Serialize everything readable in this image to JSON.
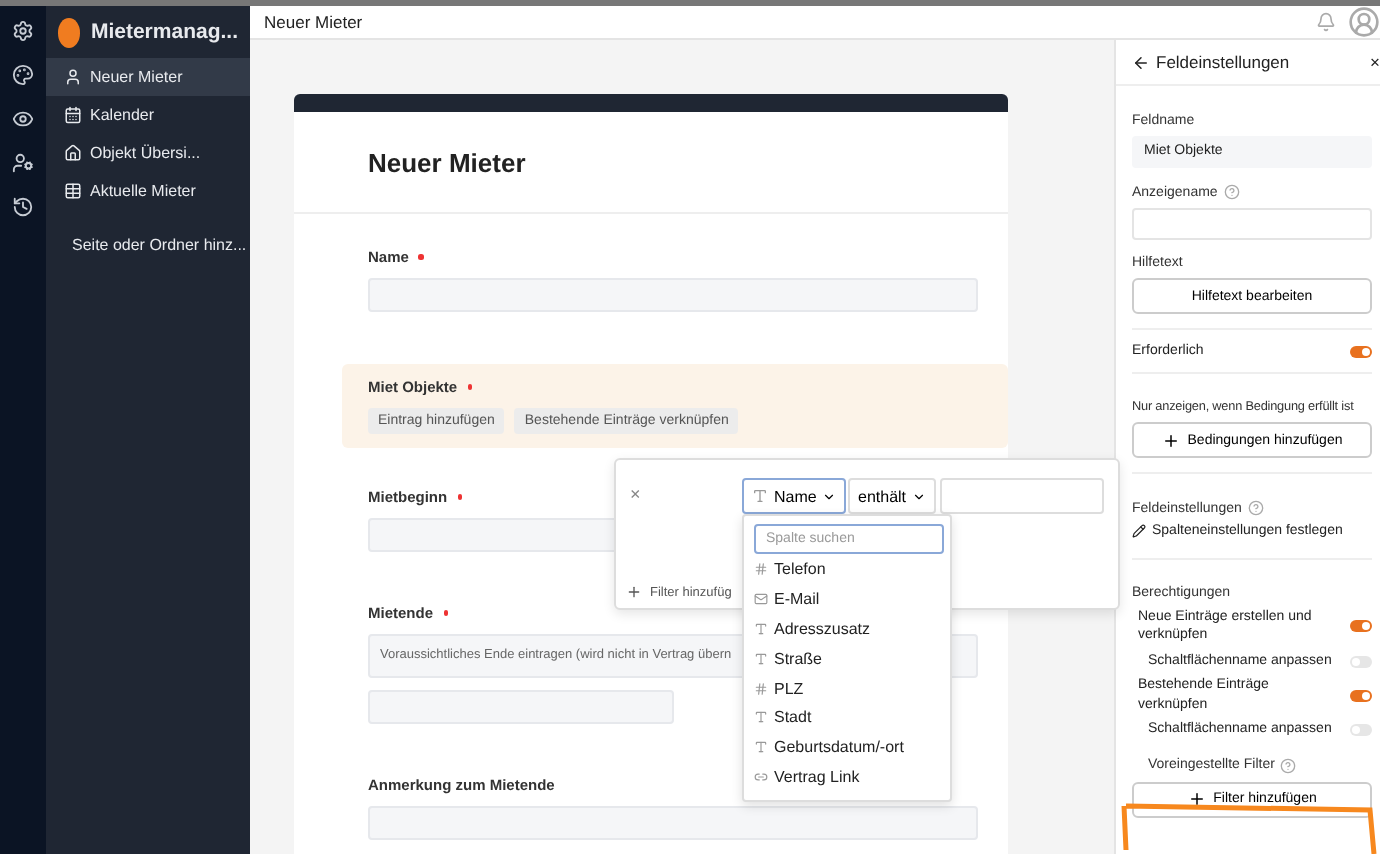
{
  "app": {
    "name": "Mietermanag..."
  },
  "rail": [
    {
      "kind": "gear"
    },
    {
      "kind": "palette"
    },
    {
      "kind": "eye"
    },
    {
      "kind": "user"
    },
    {
      "kind": "history"
    }
  ],
  "sidebar": {
    "items": [
      {
        "label": "Neuer Mieter",
        "kind": "user",
        "selected": true
      },
      {
        "label": "Kalender",
        "kind": "calendar",
        "selected": false
      },
      {
        "label": "Objekt Übersi...",
        "kind": "home",
        "selected": false
      },
      {
        "label": "Aktuelle Mieter",
        "kind": "table",
        "selected": false
      }
    ],
    "add": "Seite oder Ordner hinz..."
  },
  "header": {
    "title": "Neuer Mieter"
  },
  "form": {
    "title": "Neuer Mieter",
    "fields": [
      {
        "kind": "input",
        "label": "Name",
        "required": true,
        "highlighted": false
      },
      {
        "kind": "links",
        "label": "Miet Objekte",
        "required": true,
        "highlighted": true,
        "buttons": [
          "Eintrag hinzufügen",
          "Bestehende Einträge verknüpfen"
        ]
      },
      {
        "kind": "input",
        "label": "Mietbeginn",
        "required": true,
        "highlighted": false
      },
      {
        "kind": "date",
        "label": "Mietende",
        "required": true,
        "highlighted": false,
        "hint": "Voraussichtliches Ende eintragen (wird nicht in Vertrag übern"
      },
      {
        "kind": "input",
        "label": "Anmerkung zum Mietende",
        "required": false,
        "highlighted": false
      }
    ]
  },
  "filter": {
    "close": "×",
    "column": "Name",
    "operator": "enthält",
    "add": "Filter hinzufüg"
  },
  "column_menu": {
    "placeholder": "Spalte suchen",
    "items": [
      {
        "label": "Telefon",
        "kind": "number"
      },
      {
        "label": "E-Mail",
        "kind": "mail"
      },
      {
        "label": "Adresszusatz",
        "kind": "text"
      },
      {
        "label": "Straße",
        "kind": "text"
      },
      {
        "label": "PLZ",
        "kind": "number"
      },
      {
        "label": "Stadt",
        "kind": "text"
      },
      {
        "label": "Geburtsdatum/-ort",
        "kind": "text"
      },
      {
        "label": "Vertrag Link",
        "kind": "link"
      }
    ]
  },
  "panel": {
    "title": "Feldeinstellungen",
    "close": "×",
    "field_name_label": "Feldname",
    "field_name": "Miet Objekte",
    "display_name_label": "Anzeigename",
    "help_label": "Hilfetext",
    "help_button": "Hilfetext bearbeiten",
    "required_label": "Erforderlich",
    "required": true,
    "condition_label": "Nur anzeigen, wenn Bedingung erfüllt ist",
    "condition_button": "Bedingungen hinzufügen",
    "field_settings_label": "Feldeinstellungen",
    "field_settings_link": "Spalteneinstellungen festlegen",
    "permissions_label": "Berechtigungen",
    "permissions": [
      {
        "label": "Neue Einträge erstellen und verknüpfen",
        "on": true,
        "sub": false
      },
      {
        "label": "Schaltflächenname anpassen",
        "on": false,
        "sub": true
      },
      {
        "label": "Bestehende Einträge verknüpfen",
        "on": true,
        "sub": false
      },
      {
        "label": "Schaltflächenname anpassen",
        "on": false,
        "sub": true
      }
    ],
    "preset_filter_label": "Voreingestellte Filter",
    "preset_filter_button": "Filter hinzufügen"
  }
}
